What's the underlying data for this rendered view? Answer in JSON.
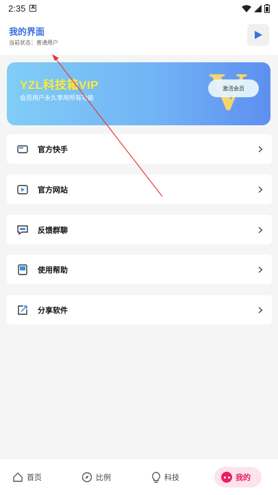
{
  "status_bar": {
    "time": "2:35"
  },
  "header": {
    "title": "我的界面",
    "status_line": "当前状态：普通用户",
    "play_icon": "play-icon"
  },
  "vip_banner": {
    "title": "YZL科技箱VIP",
    "subtitle": "会员用户永久享用所有功能",
    "badge_letter": "V",
    "activate_label": "激活会员"
  },
  "menu": [
    {
      "label": "官方快手",
      "icon": "wallet-icon"
    },
    {
      "label": "官方网站",
      "icon": "video-icon"
    },
    {
      "label": "反馈群聊",
      "icon": "chat-icon"
    },
    {
      "label": "使用帮助",
      "icon": "book-icon"
    },
    {
      "label": "分享软件",
      "icon": "share-icon"
    }
  ],
  "bottom_nav": [
    {
      "label": "首页",
      "icon": "home-icon"
    },
    {
      "label": "比例",
      "icon": "compass-icon"
    },
    {
      "label": "科技",
      "icon": "bulb-icon"
    },
    {
      "label": "我的",
      "icon": "profile-icon",
      "active": true
    }
  ],
  "colors": {
    "accent": "#3b6fe0",
    "active_tab": "#e91e63",
    "vip_gold": "#f7d56b",
    "annotation_arrow": "#e53935"
  }
}
